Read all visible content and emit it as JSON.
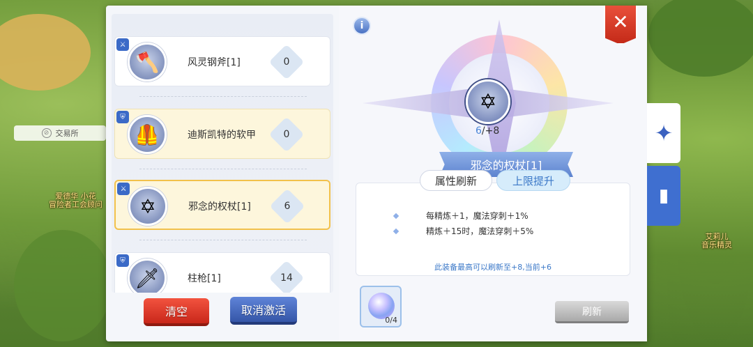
{
  "scene": {
    "trade_tag": "交易所",
    "npc_left_name": "爱德华",
    "npc_left_sub": "小花",
    "npc_left_title": "冒险者工会顾问",
    "npc_right_name": "艾莉儿",
    "npc_right_title": "音乐精灵"
  },
  "items": [
    {
      "name": "风灵钢斧[1]",
      "count": "0",
      "icon": "axe-icon",
      "style": "normal"
    },
    {
      "name": "迪斯凯特的软甲",
      "count": "0",
      "icon": "armor-icon",
      "style": "highlight"
    },
    {
      "name": "邪念的权杖[1]",
      "count": "6",
      "icon": "staff-icon",
      "style": "selected"
    },
    {
      "name": "柱枪[1]",
      "count": "14",
      "icon": "spear-icon",
      "style": "normal"
    }
  ],
  "buttons": {
    "clear": "清空",
    "cancel_activate": "取消激活",
    "refresh": "刷新"
  },
  "detail": {
    "info": "i",
    "refine_current": "6",
    "refine_rest": "/+8",
    "item_name": "邪念的权杖[1]",
    "tab_attr": "属性刷新",
    "tab_limit": "上限提升",
    "attr_lines": [
      "每精炼＋1，魔法穿刺＋1%",
      "精炼＋15时，魔法穿刺＋5%"
    ],
    "note": "此装备最高可以刷新至+8,当前+6",
    "material_count": "0/4"
  },
  "colors": {
    "accent_blue": "#3b78c8",
    "close_red": "#d8351f",
    "selected_border": "#f2c14b"
  }
}
